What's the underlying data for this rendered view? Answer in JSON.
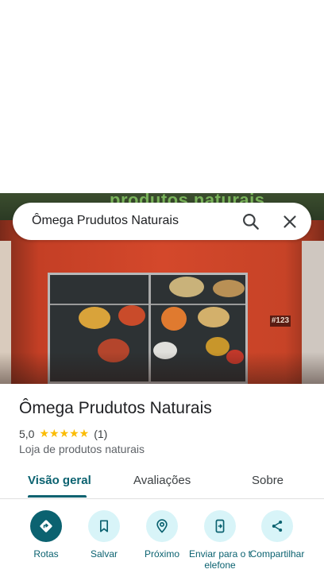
{
  "search": {
    "query": "Ômega Prudutos Naturais"
  },
  "hero": {
    "brand_text": "produtos naturais",
    "number_plate": "#123"
  },
  "place": {
    "name": "Ômega Prudutos Naturais",
    "rating": "5,0",
    "stars": "★★★★★",
    "review_count": "(1)",
    "category": "Loja de produtos naturais"
  },
  "tabs": [
    {
      "label": "Visão geral",
      "active": true
    },
    {
      "label": "Avaliações",
      "active": false
    },
    {
      "label": "Sobre",
      "active": false
    }
  ],
  "actions": [
    {
      "label": "Rotas",
      "icon": "directions-icon"
    },
    {
      "label": "Salvar",
      "icon": "bookmark-icon"
    },
    {
      "label": "Próximo",
      "icon": "nearby-icon"
    },
    {
      "label": "Enviar para o telefone",
      "icon": "send-to-phone-icon"
    },
    {
      "label": "Compartilhar",
      "icon": "share-icon"
    }
  ],
  "colors": {
    "accent": "#0b6270",
    "action_bg": "#d8f4f8",
    "star": "#fbbc04"
  }
}
